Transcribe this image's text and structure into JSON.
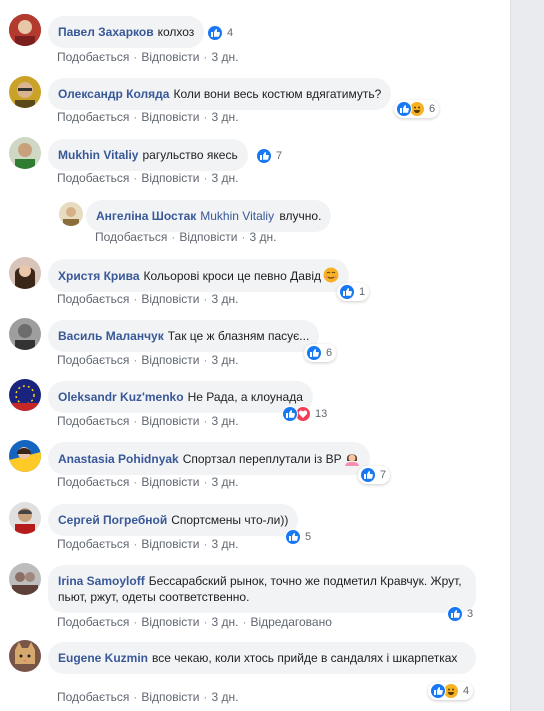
{
  "colors": {
    "author": "#385898",
    "bubble_bg": "#f2f3f5",
    "meta": "#606770",
    "like_blue": "#1877f2",
    "haha_yellow": "#f7b125",
    "love_red": "#f33e58"
  },
  "actions": {
    "like": "Подобається",
    "reply": "Відповісти",
    "edited": "Відредаговано"
  },
  "comments": [
    {
      "author": "Павел Захарков",
      "text": "колхоз",
      "time": "3 дн.",
      "reactions": [
        "like"
      ],
      "count": "4"
    },
    {
      "author": "Олександр Коляда",
      "text": "Коли вони весь костюм вдягатимуть?",
      "time": "3 дн.",
      "reactions": [
        "like",
        "haha"
      ],
      "count": "6"
    },
    {
      "author": "Mukhin Vitaliy",
      "text": "рагульство якесь",
      "time": "3 дн.",
      "reactions": [
        "like"
      ],
      "count": "7"
    },
    {
      "author": "Ангеліна Шостак",
      "mention": "Mukhin Vitaliy",
      "text": "влучно.",
      "time": "3 дн.",
      "reply": true
    },
    {
      "author": "Христя Крива",
      "text": "Кольорові кроси це певно Давід",
      "emoji": "smile-emoji",
      "time": "3 дн.",
      "reactions": [
        "like"
      ],
      "count": "1"
    },
    {
      "author": "Василь Маланчук",
      "text": "Так це ж блазням пасує...",
      "time": "3 дн.",
      "reactions": [
        "like"
      ],
      "count": "6"
    },
    {
      "author": "Oleksandr Kuz'menko",
      "text": "Не Рада, а клоунада",
      "time": "3 дн.",
      "reactions": [
        "like",
        "love"
      ],
      "count": "13"
    },
    {
      "author": "Anastasia Pohidnyak",
      "text": "Спортзал переплутали із ВР",
      "emoji": "woman-shrug-emoji",
      "time": "3 дн.",
      "reactions": [
        "like"
      ],
      "count": "7"
    },
    {
      "author": "Сергей Погребной",
      "text": "Спортсмены что-ли))",
      "time": "3 дн.",
      "reactions": [
        "like"
      ],
      "count": "5"
    },
    {
      "author": "Irina Samoyloff",
      "text": "Бессарабский рынок, точно же подметил Кравчук. Жрут, пьют, ржут, одеты соответственно.",
      "time": "3 дн.",
      "edited": true,
      "reactions": [
        "like"
      ],
      "count": "3"
    },
    {
      "author": "Eugene Kuzmin",
      "text": "все чекаю, коли хтось прийде в сандалях і шкарпетках",
      "time": "3 дн.",
      "reactions": [
        "like",
        "haha"
      ],
      "count": "4"
    }
  ]
}
